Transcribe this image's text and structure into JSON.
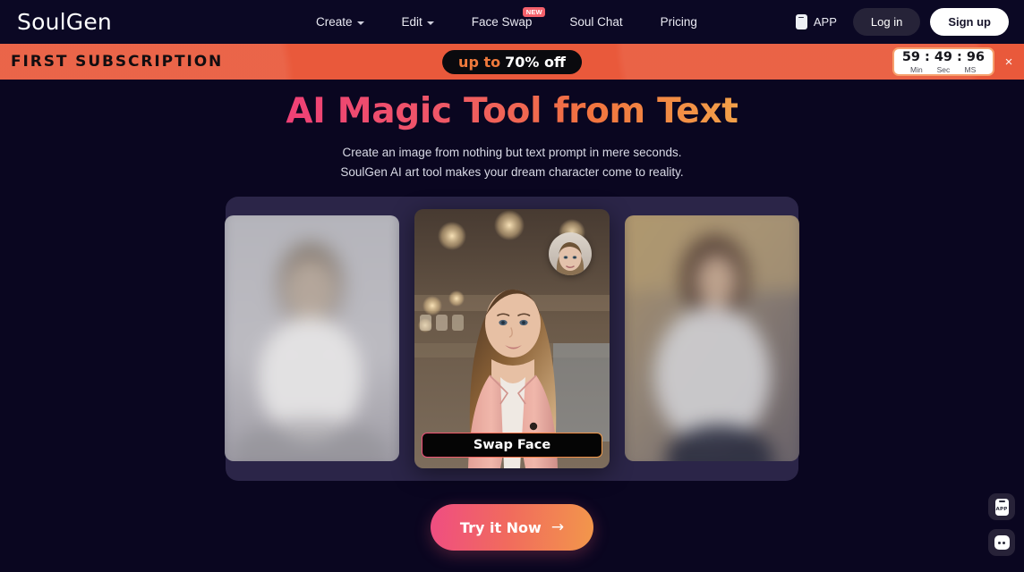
{
  "brand": {
    "name": "SoulGen"
  },
  "nav": {
    "links": [
      {
        "label": "Create",
        "has_caret": true,
        "badge": null
      },
      {
        "label": "Edit",
        "has_caret": true,
        "badge": null
      },
      {
        "label": "Face Swap",
        "has_caret": false,
        "badge": "NEW"
      },
      {
        "label": "Soul Chat",
        "has_caret": false,
        "badge": null
      },
      {
        "label": "Pricing",
        "has_caret": false,
        "badge": null
      }
    ],
    "app_label": "APP",
    "login_label": "Log in",
    "signup_label": "Sign up"
  },
  "promo": {
    "title": "FIRST SUBSCRIPTION",
    "pill_prefix": "up to",
    "pill_discount": "70% off",
    "close_icon": "×",
    "timer": {
      "minutes": "59",
      "seconds": "49",
      "millis": "96",
      "separator": ":",
      "label_minutes": "Min",
      "label_seconds": "Sec",
      "label_millis": "MS"
    },
    "colors": {
      "banner_bg": "#e9593b",
      "pill_bg": "#0a0a0e",
      "accent": "#f07a3c"
    }
  },
  "hero": {
    "title": "AI Magic Tool from Text",
    "subtitle_line1": "Create an image from nothing but text prompt in mere seconds.",
    "subtitle_line2": "SoulGen AI art tool makes your dream character come to reality.",
    "gradient_from": "#ee4076",
    "gradient_to": "#f2a049"
  },
  "carousel": {
    "cards": [
      {
        "position": "left",
        "alt": "blurred woman portrait in light room",
        "active": false
      },
      {
        "position": "center",
        "alt": "woman in pink blazer in cafe",
        "active": true
      },
      {
        "position": "right",
        "alt": "blurred woman portrait outdoors",
        "active": false
      }
    ],
    "swap_face_label": "Swap Face",
    "face_thumb_alt": "source face thumbnail"
  },
  "cta": {
    "label": "Try it Now",
    "arrow": "→"
  },
  "floating": {
    "app_label": "APP",
    "chat_label": "chat"
  }
}
